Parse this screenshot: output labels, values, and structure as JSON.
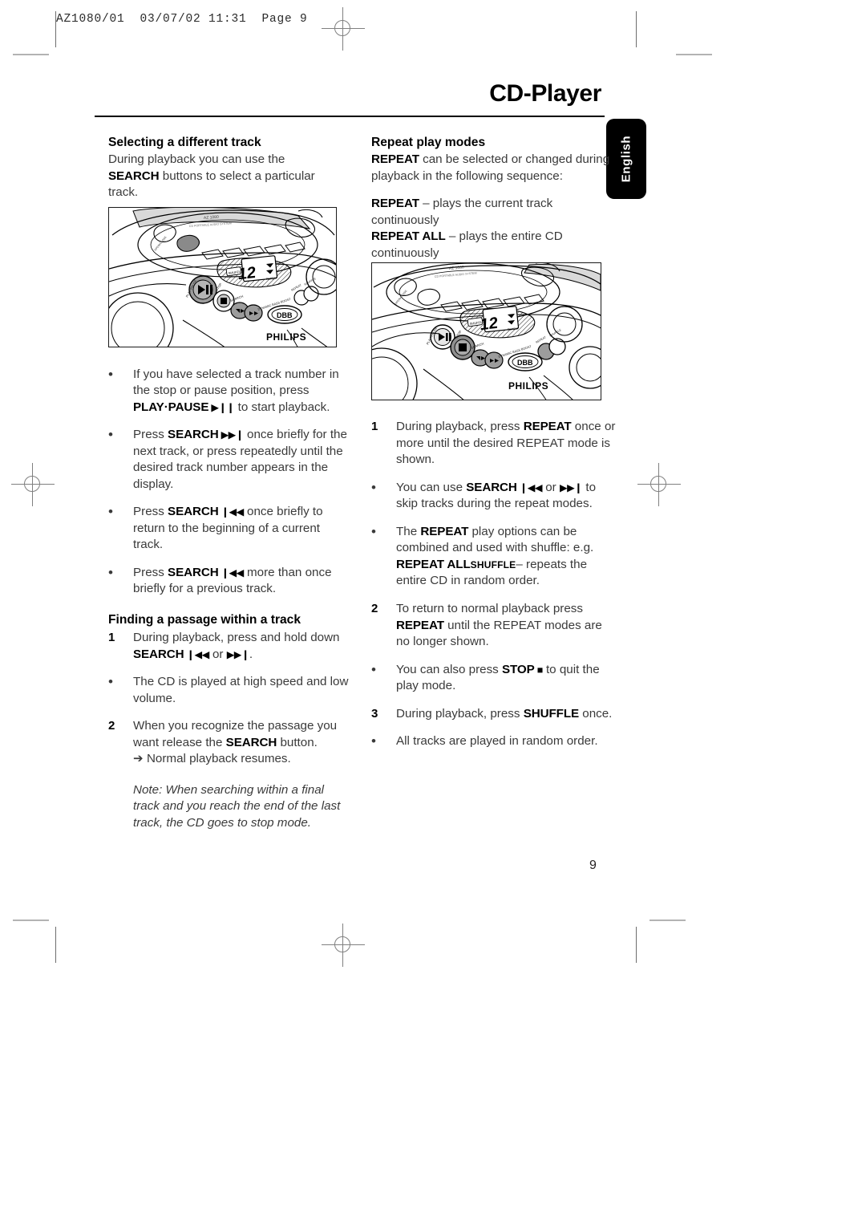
{
  "printer_slug": "AZ1080/01  03/07/02 11:31  Page 9",
  "header": {
    "title": "CD-Player",
    "language_tab": "English"
  },
  "page_number": "9",
  "colors": {
    "text": "#3a3a3a",
    "heading": "#000000",
    "tab_background": "#000000",
    "tab_text": "#ffffff",
    "rule": "#000000"
  },
  "left_column": {
    "heading": "Selecting a different track",
    "intro": {
      "line1": "During playback you can use the",
      "bold1": "SEARCH",
      "line2": " buttons to select a particular",
      "line3": "track."
    },
    "illustration_caption": "PHILIPS portable CD player control panel illustration",
    "bullets": [
      {
        "marker": "•",
        "text_a": "If you have selected a track number in the stop or pause position, press ",
        "bold": "PLAY·PAUSE",
        "glyph": "play-pause",
        "text_b": " to start playback."
      },
      {
        "marker": "•",
        "text_a": "Press ",
        "bold": "SEARCH",
        "glyph": "next-track",
        "text_b": " once briefly for the next track, or press repeatedly until the desired track number appears in the display."
      },
      {
        "marker": "•",
        "text_a": "Press ",
        "bold": "SEARCH",
        "glyph": "prev-track",
        "text_b": " once briefly to return to the beginning of a current track."
      },
      {
        "marker": "•",
        "text_a": "Press ",
        "bold": "SEARCH",
        "glyph": "prev-track",
        "text_b": " more than once briefly for a previous track."
      }
    ],
    "heading2": "Finding a passage within a track",
    "steps": [
      {
        "marker": "1",
        "text_a": "During playback, press and hold down ",
        "bold": "SEARCH",
        "glyph_a": "prev-track",
        "mid": " or ",
        "glyph_b": "next-track",
        "text_b": "."
      },
      {
        "marker": "•",
        "text_a": "The CD is played at high speed and low volume."
      },
      {
        "marker": "2",
        "text_a": "When you recognize the passage you want release the ",
        "bold": "SEARCH",
        "text_b": " button.",
        "sub_arrow": "➔ Normal playback resumes."
      }
    ],
    "note": "Note: When searching within a final track and you reach the end of the last track, the CD goes to stop mode."
  },
  "right_column": {
    "heading": "Repeat play modes",
    "intro": {
      "bold1": "REPEAT",
      "line1": " can be selected or changed during playback in the following sequence:"
    },
    "modes": [
      {
        "bold": "REPEAT",
        "text": " – plays the current track continuously"
      },
      {
        "bold": "REPEAT ALL",
        "text": " – plays the entire CD continuously"
      }
    ],
    "illustration_caption": "PHILIPS portable CD player control panel illustration",
    "steps": [
      {
        "marker": "1",
        "text_a": "During playback, press ",
        "bold": "REPEAT",
        "text_b": " once or more until the desired REPEAT mode is shown."
      },
      {
        "marker": "•",
        "text_a": "You can use ",
        "bold": "SEARCH",
        "glyph_a": "prev-track",
        "mid": " or ",
        "glyph_b": "next-track",
        "text_b": " to skip tracks during the repeat modes."
      },
      {
        "marker": "•",
        "text_a": "The ",
        "bold": "REPEAT",
        "text_b": " play options can be combined and used with shuffle: e.g.",
        "bold2": "REPEAT ALL",
        "smallcaps": "SHUFFLE",
        "text_c": "– repeats the entire CD in random order."
      },
      {
        "marker": "2",
        "text_a": "To return to normal playback press ",
        "bold": "REPEAT",
        "text_b": " until the REPEAT modes are no longer shown."
      },
      {
        "marker": "•",
        "text_a": "You can also press ",
        "bold": "STOP",
        "glyph": "stop",
        "text_b": " to quit the play mode."
      },
      {
        "marker": "3",
        "text_a": "During playback, press ",
        "bold": "SHUFFLE",
        "text_b": " once."
      },
      {
        "marker": "•",
        "text_a": "All tracks are played in random order."
      }
    ]
  },
  "illustration_labels": {
    "brand": "PHILIPS",
    "dbb": "DBB",
    "model": "AZ 1080",
    "subtitle": "CD PORTABLE AUDIO SYSTEM",
    "display_number": "12",
    "search_label": "SEARCH",
    "dbb_label": "DYNAMIC BASS BOOST",
    "play_pause_label": "PLAY•PAUSE",
    "stop_label": "STOP",
    "repeat_label": "REPEAT",
    "shuffle_label": "SHUFFLE"
  }
}
